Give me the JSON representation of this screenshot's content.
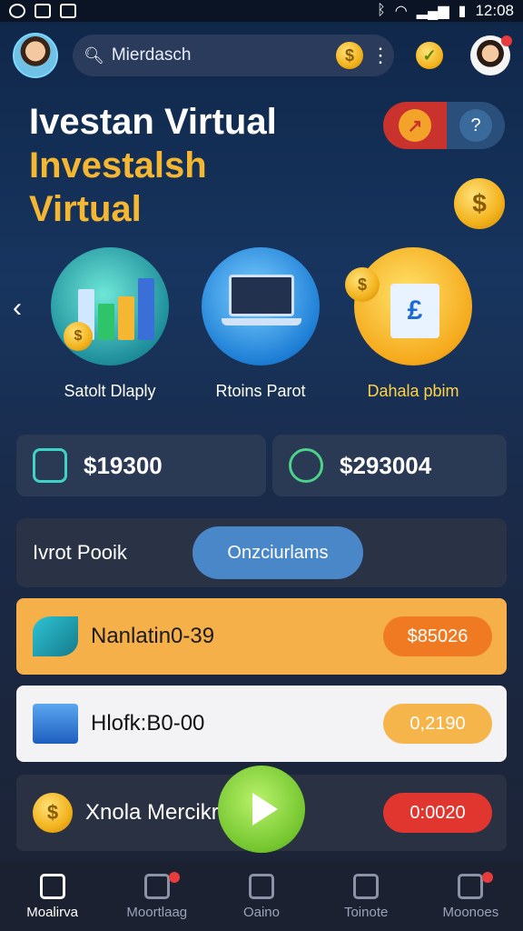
{
  "status_bar": {
    "time": "12:08"
  },
  "header": {
    "search_text": "Mierdasch",
    "coin_symbol": "$",
    "menu_symbol": "⋮",
    "check_symbol": "✓"
  },
  "hero": {
    "title_line1": "Ivestan Virtual",
    "title_line2": "Investalsh",
    "title_line3": "Virtual",
    "question_symbol": "?"
  },
  "carousel": {
    "prev_symbol": "‹",
    "items": [
      {
        "label": "Satolt Dlaply"
      },
      {
        "label": "Rtoins Parot"
      },
      {
        "label": "Dahala pbim"
      }
    ]
  },
  "stats": [
    {
      "value": "$19300"
    },
    {
      "value": "$293004"
    }
  ],
  "filter": {
    "label": "Ivrot Pooik",
    "pill": "Onzciurlams"
  },
  "investments": [
    {
      "name": "Nanlatin0-39",
      "price": "$85026"
    },
    {
      "name": "Hlofk:B0-00",
      "price": "0,2190"
    },
    {
      "name": "Xnola Mercikr",
      "price": "0:0020"
    }
  ],
  "bottom_nav": [
    {
      "label": "Moalirva"
    },
    {
      "label": "Moortlaag"
    },
    {
      "label": "Oaino"
    },
    {
      "label": "Toinote"
    },
    {
      "label": "Moonoes"
    }
  ],
  "colors": {
    "accent_gold": "#f5b731",
    "card_orange": "#f6b04a",
    "price_red": "#e0362f",
    "play_green": "#73c52e"
  }
}
